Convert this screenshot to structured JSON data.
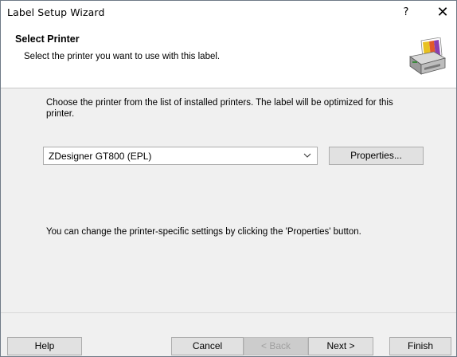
{
  "window": {
    "title": "Label Setup Wizard",
    "help_glyph": "?",
    "close_glyph": "✕"
  },
  "header": {
    "title": "Select Printer",
    "subtitle": "Select the printer you want to use with this label.",
    "icon": "printer-icon"
  },
  "main": {
    "description": "Choose the printer from the list of installed printers. The label will be optimized for this printer.",
    "printer_select": {
      "selected": "ZDesigner GT800 (EPL)"
    },
    "properties_button": "Properties...",
    "info_text": "You can change the printer-specific settings by clicking the 'Properties' button."
  },
  "footer": {
    "help": "Help",
    "cancel": "Cancel",
    "back": "< Back",
    "next": "Next >",
    "finish": "Finish"
  },
  "colors": {
    "dialog_bg": "#f0f0f0",
    "header_bg": "#ffffff",
    "button_bg": "#e1e1e1",
    "disabled_text": "#a0a0a0"
  }
}
